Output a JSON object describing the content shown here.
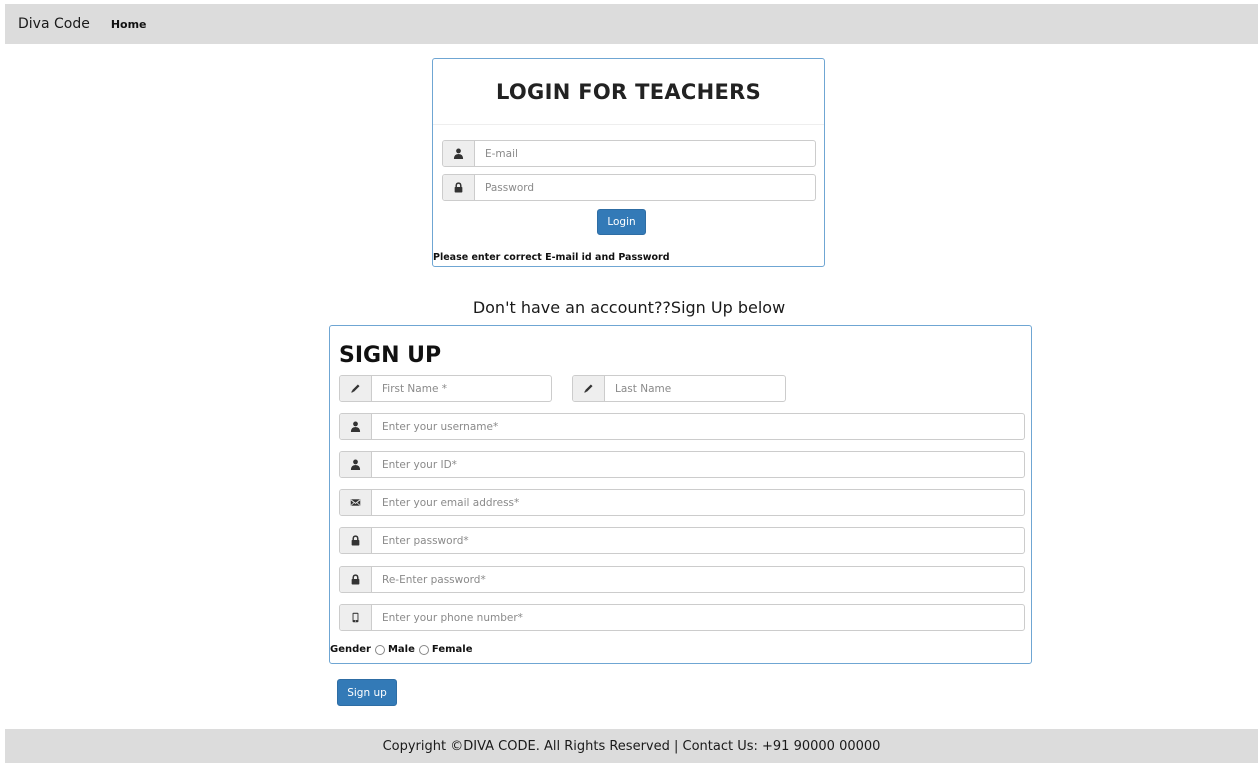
{
  "navbar": {
    "brand": "Diva Code",
    "home": "Home"
  },
  "login": {
    "title": "LOGIN FOR TEACHERS",
    "email_placeholder": "E-mail",
    "password_placeholder": "Password",
    "button": "Login",
    "message": "Please enter correct E-mail id and Password"
  },
  "signup_caption": "Don't have an account??Sign Up below",
  "signup": {
    "title": "SIGN UP",
    "first_name_placeholder": "First Name *",
    "last_name_placeholder": "Last Name",
    "username_placeholder": "Enter your username*",
    "id_placeholder": "Enter your ID*",
    "email_placeholder": "Enter your email address*",
    "password_placeholder": "Enter password*",
    "repassword_placeholder": "Re-Enter password*",
    "phone_placeholder": "Enter your phone number*",
    "gender_label": "Gender",
    "male_label": "Male",
    "female_label": "Female",
    "button": "Sign up"
  },
  "footer": {
    "text": "Copyright ©DIVA CODE. All Rights Reserved | Contact Us: +91 90000 00000"
  },
  "colors": {
    "primary": "#337ab7",
    "panel_border": "#6fa6d3",
    "bar_bg": "#dcdcdc"
  },
  "icons": {
    "user": "user-icon",
    "lock": "lock-icon",
    "pencil": "pencil-icon",
    "envelope": "envelope-icon",
    "phone": "phone-icon"
  }
}
